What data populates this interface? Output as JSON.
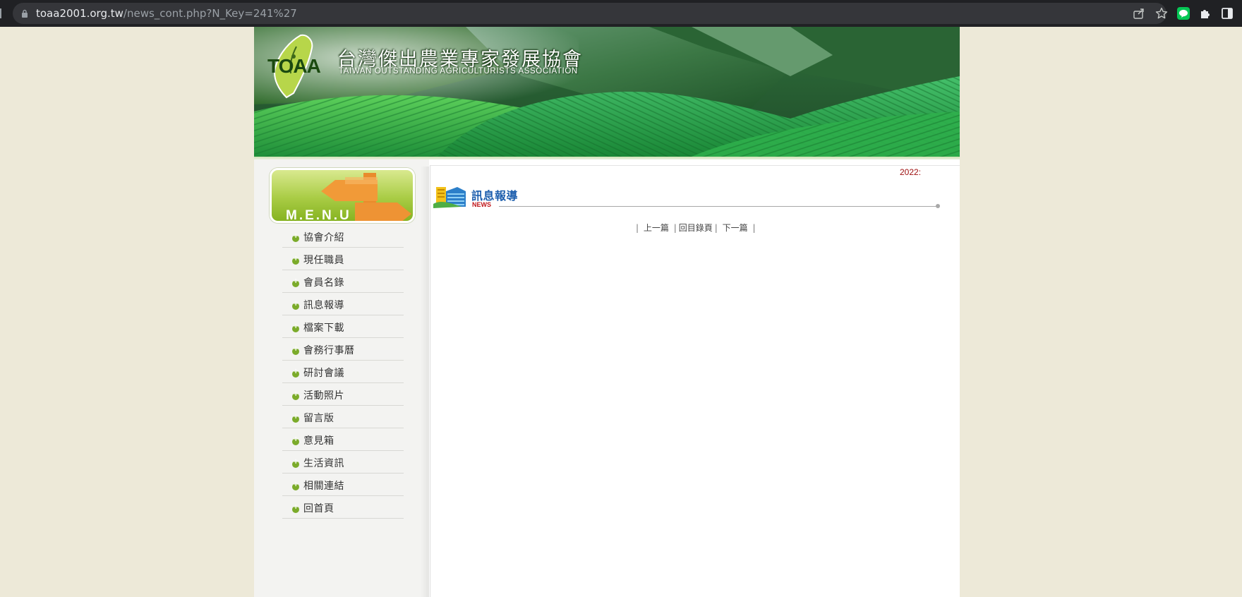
{
  "browser": {
    "url_host": "toaa2001.org.tw",
    "url_path": "/news_cont.php?N_Key=241%27",
    "icons": [
      "lock-icon",
      "share-icon",
      "star-icon",
      "line-extension-icon",
      "puzzle-extensions-icon",
      "side-panel-icon"
    ]
  },
  "header": {
    "logo_abbr": "TOAA",
    "org_name_cn": "台灣傑出農業專家發展協會",
    "org_name_en": "TAIWAN OUTSTANDING AGRICULTURISTS ASSOCIATION"
  },
  "sidebar": {
    "menu_badge": "M.E.N.U",
    "items": [
      {
        "label": "協會介紹"
      },
      {
        "label": "現任職員"
      },
      {
        "label": "會員名錄"
      },
      {
        "label": "訊息報導"
      },
      {
        "label": "檔案下載"
      },
      {
        "label": "會務行事曆"
      },
      {
        "label": "研討會議"
      },
      {
        "label": "活動照片"
      },
      {
        "label": "留言版"
      },
      {
        "label": "意見箱"
      },
      {
        "label": "生活資訊"
      },
      {
        "label": "相關連結"
      },
      {
        "label": "回首頁"
      }
    ]
  },
  "content": {
    "ticker": "2022:",
    "section_title": "訊息報導",
    "section_sub": "NEWS",
    "pager": {
      "prev": "上一篇",
      "back": "回目錄頁",
      "next": "下一篇",
      "separator": "|"
    }
  },
  "colors": {
    "page_bg": "#ede9d8",
    "title_blue": "#1e5fae",
    "accent_red": "#c0171b",
    "menu_green": "#7bab2a"
  }
}
